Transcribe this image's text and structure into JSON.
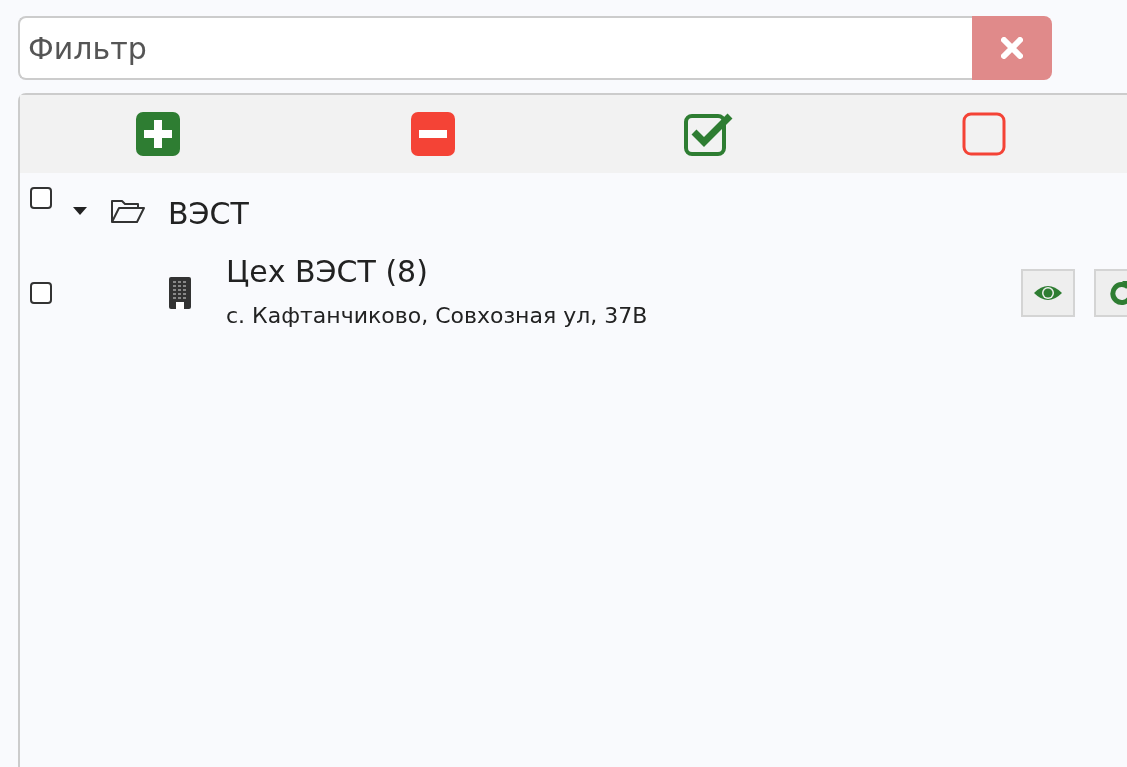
{
  "filter": {
    "placeholder": "Фильтр"
  },
  "toolbar": [
    {
      "kind": "expand-all"
    },
    {
      "kind": "collapse-all"
    },
    {
      "kind": "check-all"
    },
    {
      "kind": "uncheck-all"
    }
  ],
  "tree": [
    {
      "kind": "folder",
      "label": "ВЭСТ",
      "checked": false,
      "expanded": true,
      "children": [
        {
          "kind": "building",
          "label": "Цех ВЭСТ (8)",
          "address": "с. Кафтанчиково, Совхозная ул, 37В",
          "checked": false,
          "actions": [
            {
              "kind": "view"
            },
            {
              "kind": "refresh"
            }
          ]
        }
      ]
    }
  ]
}
